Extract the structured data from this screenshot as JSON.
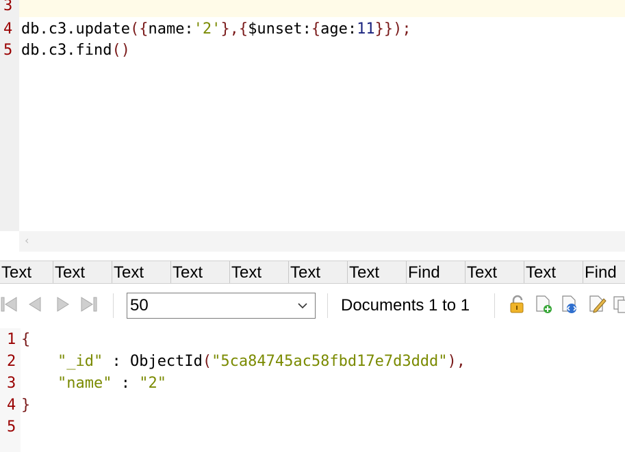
{
  "editor": {
    "lines": [
      {
        "num": "3",
        "segments": []
      },
      {
        "num": "4",
        "segments": [
          {
            "text": "db.c3.update",
            "cls": ""
          },
          {
            "text": "({",
            "cls": "c-br"
          },
          {
            "text": "name:",
            "cls": ""
          },
          {
            "text": "'2'",
            "cls": "c-str"
          },
          {
            "text": "},{",
            "cls": "c-br"
          },
          {
            "text": "$unset:",
            "cls": ""
          },
          {
            "text": "{",
            "cls": "c-br"
          },
          {
            "text": "age:",
            "cls": ""
          },
          {
            "text": "11",
            "cls": "c-num"
          },
          {
            "text": "}});",
            "cls": "c-br"
          }
        ]
      },
      {
        "num": "5",
        "segments": [
          {
            "text": "db.c3.find",
            "cls": ""
          },
          {
            "text": "()",
            "cls": "c-br"
          }
        ]
      }
    ],
    "scroll_left_glyph": "‹"
  },
  "tabs": [
    "Text",
    "Text",
    "Text",
    "Text",
    "Text",
    "Text",
    "Text",
    "Find",
    "Text",
    "Text",
    "Find"
  ],
  "toolbar": {
    "page_size": "50",
    "documents_label": "Documents 1 to 1"
  },
  "result": {
    "lines": [
      {
        "num": "1",
        "segments": [
          {
            "text": "{",
            "cls": "c-br"
          }
        ]
      },
      {
        "num": "2",
        "segments": [
          {
            "text": "    ",
            "cls": ""
          },
          {
            "text": "\"_id\"",
            "cls": "c-str"
          },
          {
            "text": " : ObjectId",
            "cls": ""
          },
          {
            "text": "(",
            "cls": "c-br"
          },
          {
            "text": "\"5ca84745ac58fbd17e7d3ddd\"",
            "cls": "c-str"
          },
          {
            "text": "),",
            "cls": "c-br"
          }
        ]
      },
      {
        "num": "3",
        "segments": [
          {
            "text": "    ",
            "cls": ""
          },
          {
            "text": "\"name\"",
            "cls": "c-str"
          },
          {
            "text": " : ",
            "cls": ""
          },
          {
            "text": "\"2\"",
            "cls": "c-str"
          }
        ]
      },
      {
        "num": "4",
        "segments": [
          {
            "text": "}",
            "cls": "c-br"
          }
        ]
      },
      {
        "num": "5",
        "segments": []
      }
    ]
  },
  "colors": {
    "gutter_num": "#990000",
    "bracket": "#7a1a1a",
    "string": "#7a8a00",
    "number": "#1a237e"
  },
  "icons": {
    "nav": [
      "first-page-icon",
      "prev-page-icon",
      "next-page-icon",
      "last-page-icon"
    ],
    "actions": [
      "lock-icon",
      "new-document-icon",
      "view-json-icon",
      "edit-document-icon",
      "copy-icon"
    ]
  }
}
